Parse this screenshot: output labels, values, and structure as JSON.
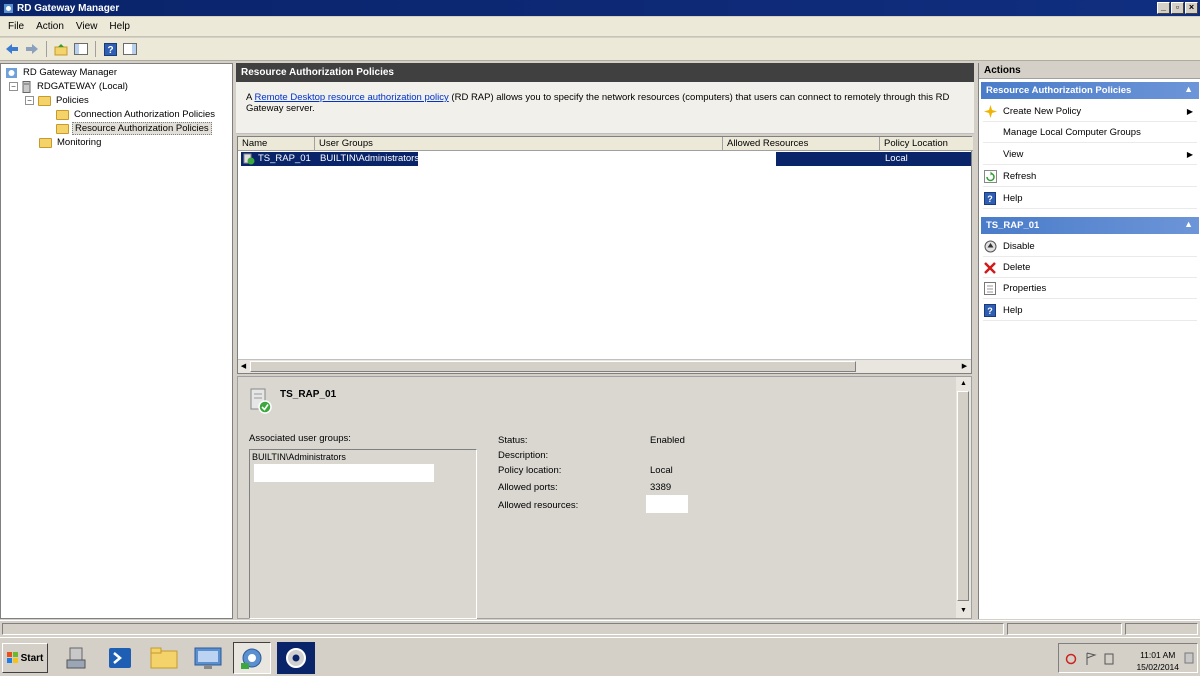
{
  "window": {
    "title": "RD Gateway Manager"
  },
  "menu": [
    "File",
    "Action",
    "View",
    "Help"
  ],
  "tree": {
    "root": "RD Gateway Manager",
    "server": "RDGATEWAY (Local)",
    "policies": "Policies",
    "cap": "Connection Authorization Policies",
    "rap": "Resource Authorization Policies",
    "monitoring": "Monitoring"
  },
  "main": {
    "header": "Resource Authorization Policies",
    "info_prefix": "A ",
    "info_link": "Remote Desktop resource authorization policy",
    "info_suffix": " (RD RAP) allows you to specify the network resources (computers) that users can connect to remotely through this RD Gateway server.",
    "columns": [
      "Name",
      "User Groups",
      "Allowed Resources",
      "Policy Location"
    ],
    "row": {
      "name": "TS_RAP_01",
      "user_groups": "BUILTIN\\Administrators",
      "location": "Local"
    }
  },
  "details": {
    "title": "TS_RAP_01",
    "assoc_label": "Associated user groups:",
    "assoc_value": "BUILTIN\\Administrators",
    "labels": {
      "status": "Status:",
      "description": "Description:",
      "location": "Policy location:",
      "ports": "Allowed ports:",
      "resources": "Allowed resources:"
    },
    "values": {
      "status": "Enabled",
      "location": "Local",
      "ports": "3389"
    }
  },
  "actions": {
    "header": "Actions",
    "section1": "Resource Authorization Policies",
    "s1_items": [
      "Create New Policy",
      "Manage Local Computer Groups",
      "View",
      "Refresh",
      "Help"
    ],
    "section2": "TS_RAP_01",
    "s2_items": [
      "Disable",
      "Delete",
      "Properties",
      "Help"
    ]
  },
  "taskbar": {
    "start": "Start",
    "time": "11:01 AM",
    "date": "15/02/2014"
  },
  "colors": {
    "title": "#0a246a",
    "selection": "#0a246a",
    "section": "#4a7cc9"
  }
}
